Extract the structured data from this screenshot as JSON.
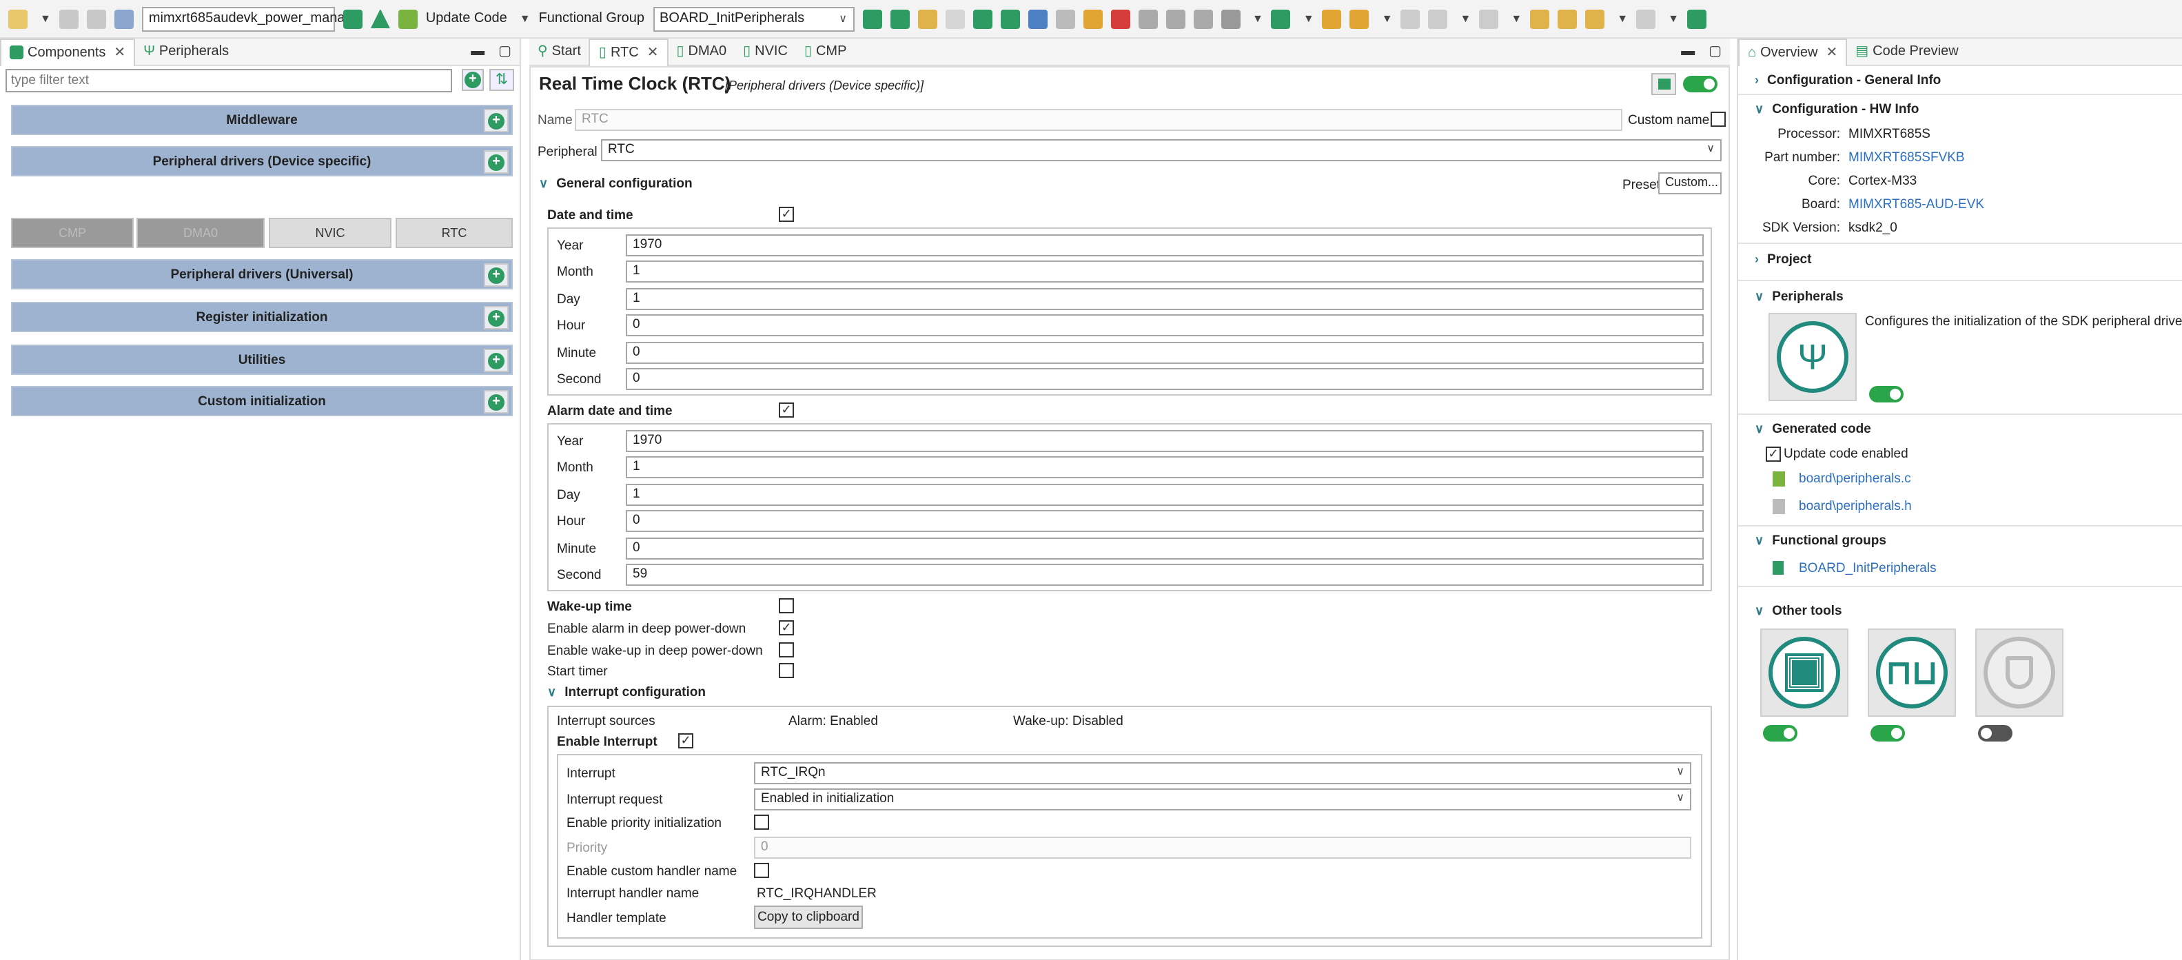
{
  "toolbar": {
    "project_combo": "mimxrt685audevk_power_mana",
    "update_code_label": "Update Code",
    "functional_group_label": "Functional Group",
    "functional_group_value": "BOARD_InitPeripherals"
  },
  "left": {
    "tabs": [
      {
        "label": "Components"
      },
      {
        "label": "Peripherals"
      }
    ],
    "filter_placeholder": "type filter text",
    "groups": [
      {
        "label": "Middleware"
      },
      {
        "label": "Peripheral drivers (Device specific)"
      },
      {
        "label": "Peripheral drivers (Universal)"
      },
      {
        "label": "Register initialization"
      },
      {
        "label": "Utilities"
      },
      {
        "label": "Custom initialization"
      }
    ],
    "components": [
      "CMP",
      "DMA0",
      "NVIC",
      "RTC"
    ]
  },
  "center": {
    "tabs": [
      {
        "label": "Start"
      },
      {
        "label": "RTC"
      },
      {
        "label": "DMA0"
      },
      {
        "label": "NVIC"
      },
      {
        "label": "CMP"
      }
    ],
    "title": "Real Time Clock (RTC)",
    "subtitle": "[Peripheral drivers (Device specific)]",
    "name_label": "Name",
    "name_value": "RTC",
    "custom_name_label": "Custom name",
    "peripheral_label": "Peripheral",
    "peripheral_value": "RTC",
    "general_config_label": "General configuration",
    "preset_label": "Preset",
    "preset_value": "Custom...",
    "date_time": {
      "label": "Date and time",
      "rows": [
        {
          "label": "Year",
          "value": "1970"
        },
        {
          "label": "Month",
          "value": "1"
        },
        {
          "label": "Day",
          "value": "1"
        },
        {
          "label": "Hour",
          "value": "0"
        },
        {
          "label": "Minute",
          "value": "0"
        },
        {
          "label": "Second",
          "value": "0"
        }
      ]
    },
    "alarm": {
      "label": "Alarm date and time",
      "rows": [
        {
          "label": "Year",
          "value": "1970"
        },
        {
          "label": "Month",
          "value": "1"
        },
        {
          "label": "Day",
          "value": "1"
        },
        {
          "label": "Hour",
          "value": "0"
        },
        {
          "label": "Minute",
          "value": "0"
        },
        {
          "label": "Second",
          "value": "59"
        }
      ]
    },
    "wakeup_label": "Wake-up time",
    "enable_alarm_label": "Enable alarm in deep power-down",
    "enable_wakeup_label": "Enable wake-up in deep power-down",
    "start_timer_label": "Start timer",
    "interrupt": {
      "header": "Interrupt configuration",
      "sources_label": "Interrupt sources",
      "alarm_status": "Alarm:  Enabled",
      "wakeup_status": "Wake-up:  Disabled",
      "enable_label": "Enable Interrupt",
      "interrupt_label": "Interrupt",
      "interrupt_value": "RTC_IRQn",
      "request_label": "Interrupt request",
      "request_value": "Enabled in initialization",
      "priority_init_label": "Enable priority initialization",
      "priority_label": "Priority",
      "priority_value": "0",
      "custom_handler_label": "Enable custom handler name",
      "handler_name_label": "Interrupt handler name",
      "handler_name_value": "RTC_IRQHANDLER",
      "template_label": "Handler template",
      "copy_button": "Copy to clipboard"
    }
  },
  "right": {
    "tabs": [
      {
        "label": "Overview"
      },
      {
        "label": "Code Preview"
      }
    ],
    "general_info": "Configuration - General Info",
    "hw_info": "Configuration - HW Info",
    "hw_rows": [
      {
        "key": "Processor:",
        "value": "MIMXRT685S",
        "link": false
      },
      {
        "key": "Part number:",
        "value": "MIMXRT685SFVKB",
        "link": true
      },
      {
        "key": "Core:",
        "value": "Cortex-M33",
        "link": false
      },
      {
        "key": "Board:",
        "value": "MIMXRT685-AUD-EVK",
        "link": true
      },
      {
        "key": "SDK Version:",
        "value": "ksdk2_0",
        "link": false
      }
    ],
    "project": "Project",
    "peripherals": "Peripherals",
    "peripherals_desc": "Configures the initialization of the SDK peripheral driver",
    "generated_code": "Generated code",
    "update_code_enabled": "Update code enabled",
    "files": [
      "board\\peripherals.c",
      "board\\peripherals.h"
    ],
    "functional_groups": "Functional groups",
    "fg_item": "BOARD_InitPeripherals",
    "other_tools": "Other tools"
  },
  "colors": {
    "accent_green": "#2aa54a",
    "teal": "#1f8a7d",
    "group_blue": "#9db3d0",
    "link_blue": "#2b6fc1"
  }
}
